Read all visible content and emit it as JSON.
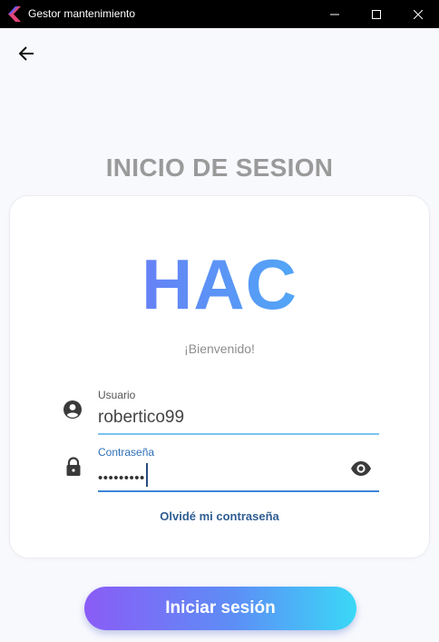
{
  "window": {
    "title": "Gestor mantenimiento",
    "app_icon": "app-logo-icon",
    "controls": [
      "minimize-icon",
      "maximize-icon",
      "close-icon"
    ]
  },
  "nav": {
    "back_icon": "arrow-left-icon"
  },
  "page": {
    "title": "INICIO DE SESION"
  },
  "card": {
    "logo_text": "HAC",
    "welcome": "¡Bienvenido!",
    "username": {
      "label": "Usuario",
      "value": "robertico99",
      "icon": "account-circle-icon"
    },
    "password": {
      "label": "Contraseña",
      "value": "•••••••••",
      "icon": "lock-icon",
      "toggle_icon": "eye-icon"
    },
    "forgot_link": "Olvidé mi contraseña"
  },
  "actions": {
    "login_label": "Iniciar sesión"
  },
  "colors": {
    "titlebar": "#000000",
    "background": "#f8f9fd",
    "title_gray": "#9a9a9a",
    "gradient_start": "#8a5cf6",
    "gradient_end": "#3ad8f6",
    "link": "#2f5d92",
    "field_underline": "#7cc3f0",
    "field_focus": "#3d86d6"
  }
}
